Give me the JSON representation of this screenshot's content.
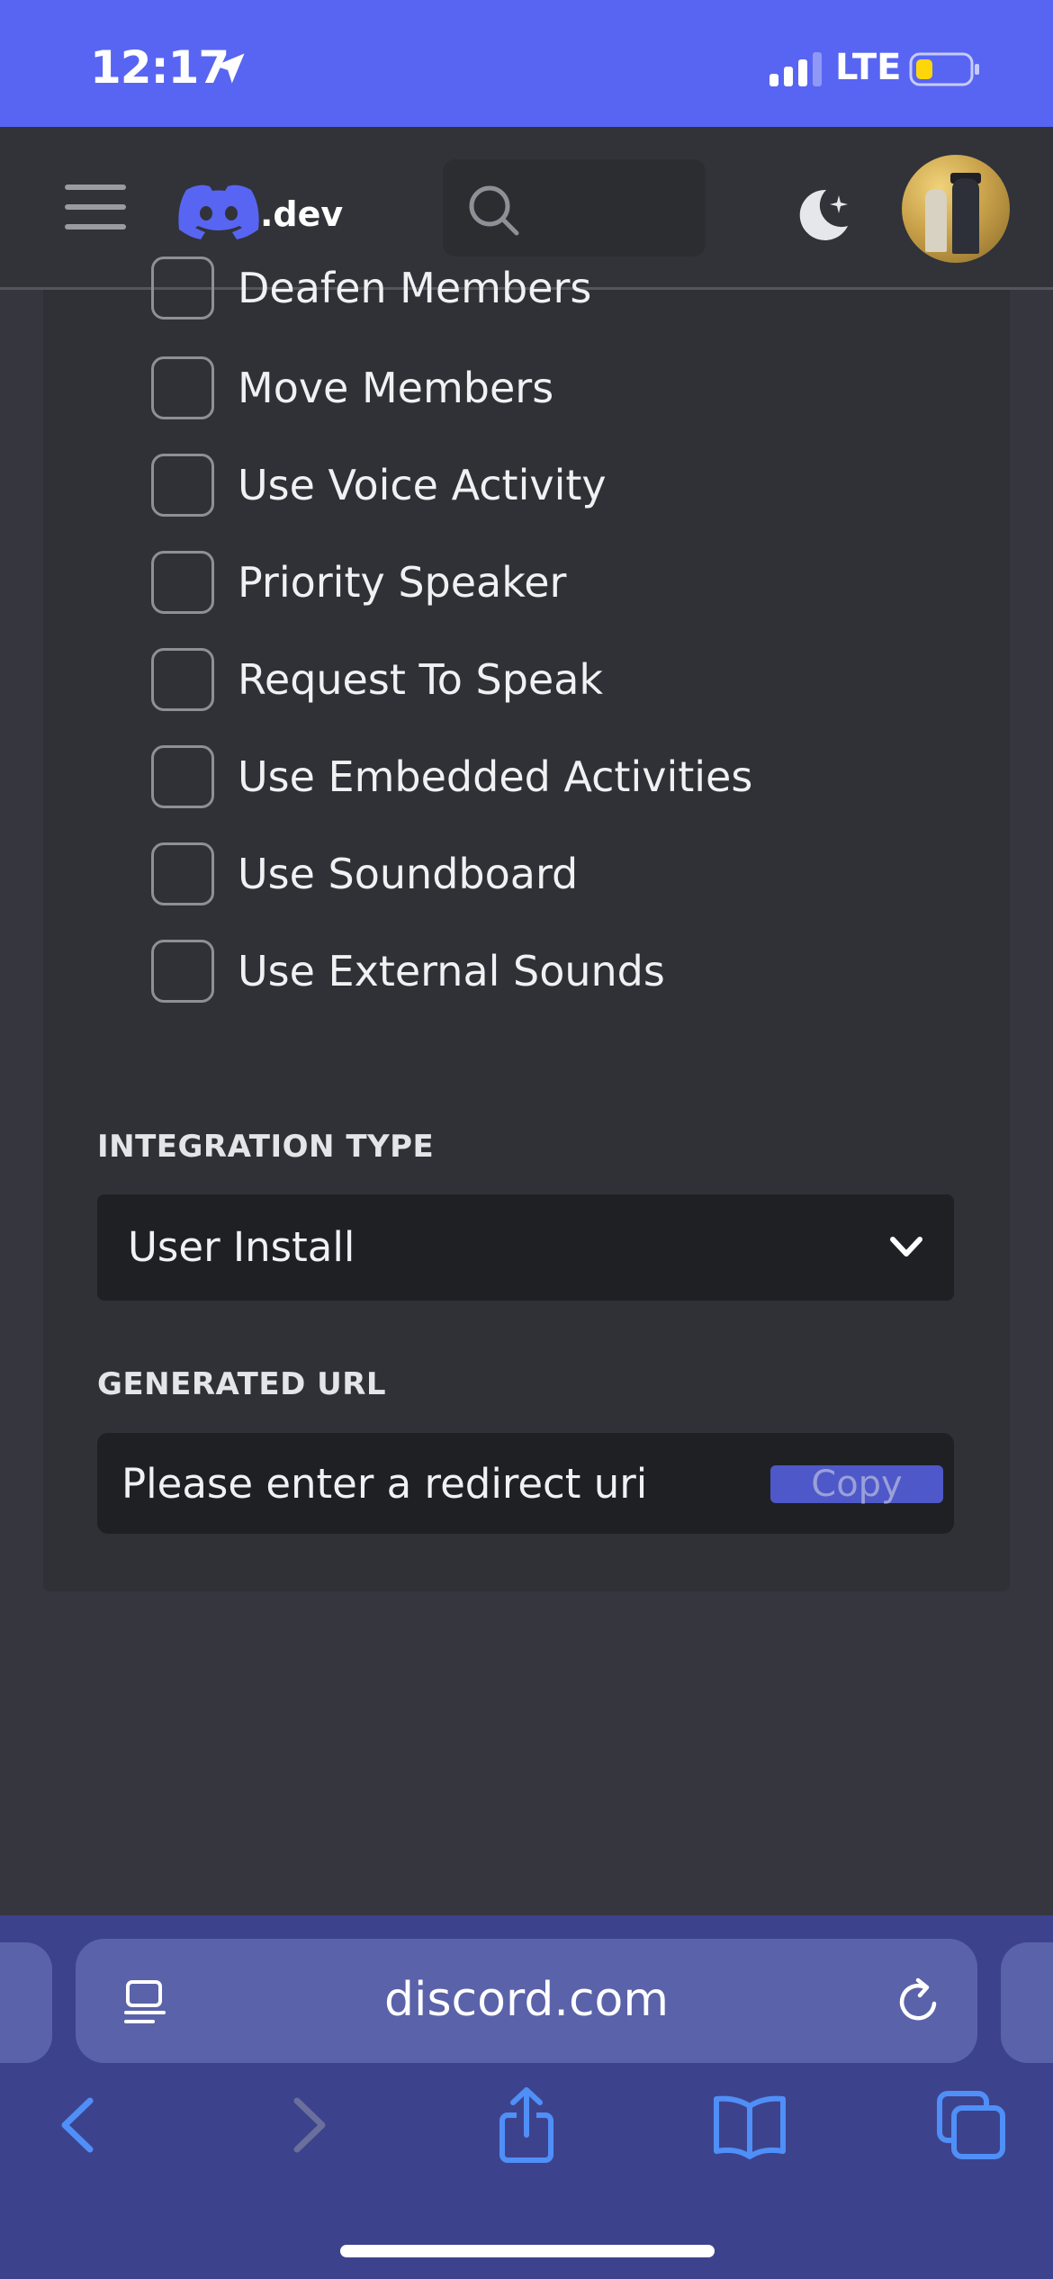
{
  "status_bar": {
    "time": "12:17",
    "network": "LTE",
    "bg_color": "#5865f2"
  },
  "header": {
    "logo_text": ".dev",
    "search_placeholder": ""
  },
  "permissions": [
    "Deafen Members",
    "Move Members",
    "Use Voice Activity",
    "Priority Speaker",
    "Request To Speak",
    "Use Embedded Activities",
    "Use Soundboard",
    "Use External Sounds"
  ],
  "integration_type": {
    "label": "INTEGRATION TYPE",
    "value": "User Install"
  },
  "generated_url": {
    "label": "GENERATED URL",
    "value": "Please enter a redirect uri",
    "copy_label": "Copy"
  },
  "browser": {
    "address": "discord.com"
  },
  "colors": {
    "accent": "#5865f2",
    "panel": "#303136",
    "page": "#36363e",
    "safari_bar": "#3c438c"
  }
}
